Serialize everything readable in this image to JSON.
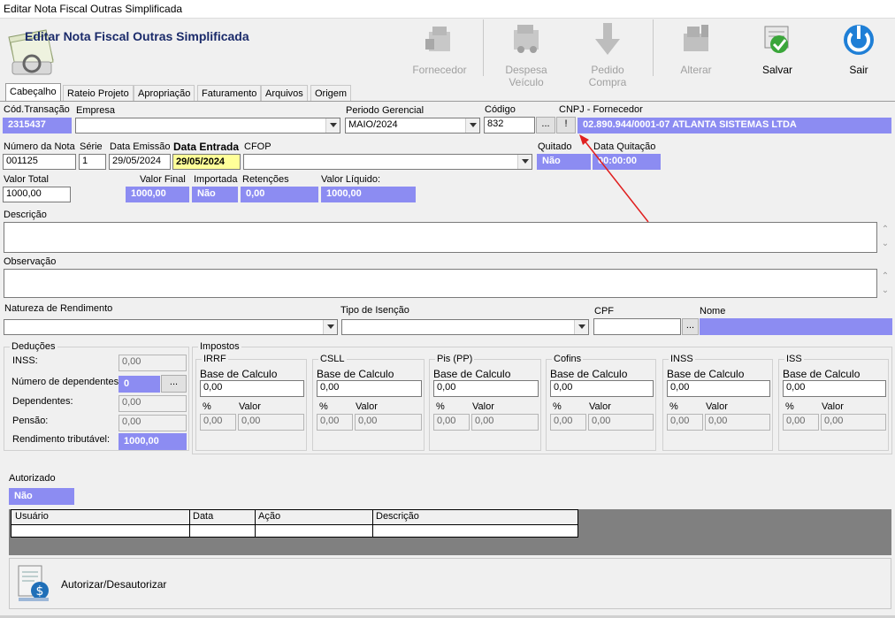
{
  "window_title": "Editar Nota Fiscal Outras Simplificada",
  "header_title": "Editar Nota Fiscal Outras Simplificada",
  "toolbar": {
    "fornecedor": "Fornecedor",
    "despesa_veiculo": "Despesa Veículo",
    "pedido_compra": "Pedido Compra",
    "alterar": "Alterar",
    "salvar": "Salvar",
    "sair": "Sair"
  },
  "tabs": [
    "Cabeçalho",
    "Rateio Projeto",
    "Apropriação",
    "Faturamento",
    "Arquivos",
    "Origem"
  ],
  "labels": {
    "cod_transacao": "Cód.Transação",
    "empresa": "Empresa",
    "periodo": "Periodo Gerencial",
    "codigo": "Código",
    "cnpj": "CNPJ - Fornecedor",
    "numero_nota": "Número da Nota",
    "serie": "Série",
    "data_emissao": "Data Emissão",
    "data_entrada": "Data Entrada",
    "cfop": "CFOP",
    "quitado": "Quitado",
    "data_quitacao": "Data Quitação",
    "valor_total": "Valor Total",
    "valor_final": "Valor Final",
    "importada": "Importada",
    "retencoes": "Retenções",
    "valor_liquido": "Valor Líquido:",
    "descricao": "Descrição",
    "observacao": "Observação",
    "natureza": "Natureza de Rendimento",
    "tipo_isencao": "Tipo de Isenção",
    "cpf": "CPF",
    "nome": "Nome",
    "autorizado": "Autorizado"
  },
  "values": {
    "cod_transacao": "2315437",
    "empresa": "",
    "periodo": "MAIO/2024",
    "codigo": "832",
    "cnpj_fornecedor": "02.890.944/0001-07  ATLANTA SISTEMAS LTDA",
    "numero_nota": "001125",
    "serie": "1",
    "data_emissao": "29/05/2024",
    "data_entrada": "29/05/2024",
    "cfop": "",
    "quitado": "Não",
    "data_quitacao": "00:00:00",
    "valor_total": "1000,00",
    "valor_final": "1000,00",
    "importada": "Não",
    "retencoes": "0,00",
    "valor_liquido": "1000,00",
    "autorizado": "Não"
  },
  "buttons": {
    "ellipsis": "...",
    "exclaim": "!"
  },
  "deducoes": {
    "legend": "Deduções",
    "inss_label": "INSS:",
    "inss": "0,00",
    "dependentes_num_label": "Número de dependentes:",
    "dependentes_num": "0",
    "dependentes_label": "Dependentes:",
    "dependentes": "0,00",
    "pensao_label": "Pensão:",
    "pensao": "0,00",
    "rendimento_label": "Rendimento tributável:",
    "rendimento": "1000,00"
  },
  "impostos": {
    "legend": "Impostos",
    "base_label": "Base de Calculo",
    "pct_label": "%",
    "valor_label": "Valor",
    "groups": [
      {
        "name": "IRRF",
        "base": "0,00",
        "pct": "0,00",
        "valor": "0,00"
      },
      {
        "name": "CSLL",
        "base": "0,00",
        "pct": "0,00",
        "valor": "0,00"
      },
      {
        "name": "Pis (PP)",
        "base": "0,00",
        "pct": "0,00",
        "valor": "0,00"
      },
      {
        "name": "Cofins",
        "base": "0,00",
        "pct": "0,00",
        "valor": "0,00"
      },
      {
        "name": "INSS",
        "base": "0,00",
        "pct": "0,00",
        "valor": "0,00"
      },
      {
        "name": "ISS",
        "base": "0,00",
        "pct": "0,00",
        "valor": "0,00"
      }
    ]
  },
  "grid": {
    "columns": [
      "Usuário",
      "Data",
      "Ação",
      "Descrição"
    ]
  },
  "autorizar_button": "Autorizar/Desautorizar",
  "colors": {
    "readonly_bg": "#8c8cf2",
    "highlight_yellow": "#ffff99",
    "annotation_arrow": "#e02020",
    "grid_gray": "#808080"
  }
}
